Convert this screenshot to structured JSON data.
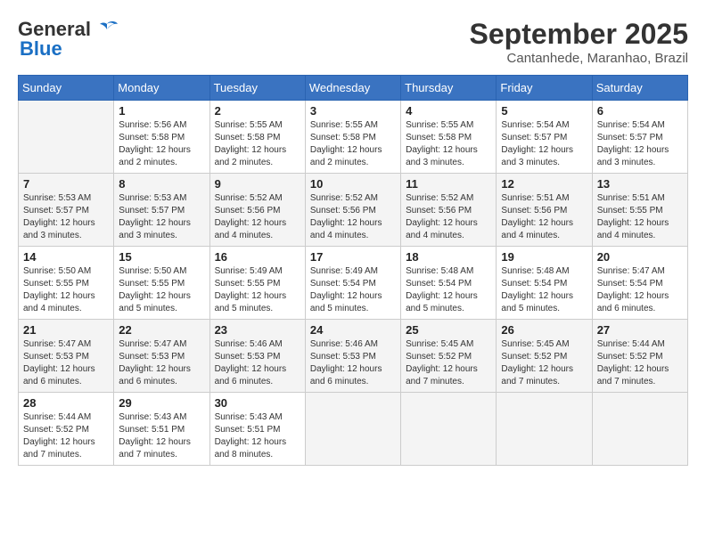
{
  "header": {
    "logo_line1": "General",
    "logo_line2": "Blue",
    "month": "September 2025",
    "location": "Cantanhede, Maranhao, Brazil"
  },
  "days_of_week": [
    "Sunday",
    "Monday",
    "Tuesday",
    "Wednesday",
    "Thursday",
    "Friday",
    "Saturday"
  ],
  "weeks": [
    [
      {
        "day": "",
        "info": ""
      },
      {
        "day": "1",
        "info": "Sunrise: 5:56 AM\nSunset: 5:58 PM\nDaylight: 12 hours\nand 2 minutes."
      },
      {
        "day": "2",
        "info": "Sunrise: 5:55 AM\nSunset: 5:58 PM\nDaylight: 12 hours\nand 2 minutes."
      },
      {
        "day": "3",
        "info": "Sunrise: 5:55 AM\nSunset: 5:58 PM\nDaylight: 12 hours\nand 2 minutes."
      },
      {
        "day": "4",
        "info": "Sunrise: 5:55 AM\nSunset: 5:58 PM\nDaylight: 12 hours\nand 3 minutes."
      },
      {
        "day": "5",
        "info": "Sunrise: 5:54 AM\nSunset: 5:57 PM\nDaylight: 12 hours\nand 3 minutes."
      },
      {
        "day": "6",
        "info": "Sunrise: 5:54 AM\nSunset: 5:57 PM\nDaylight: 12 hours\nand 3 minutes."
      }
    ],
    [
      {
        "day": "7",
        "info": "Sunrise: 5:53 AM\nSunset: 5:57 PM\nDaylight: 12 hours\nand 3 minutes."
      },
      {
        "day": "8",
        "info": "Sunrise: 5:53 AM\nSunset: 5:57 PM\nDaylight: 12 hours\nand 3 minutes."
      },
      {
        "day": "9",
        "info": "Sunrise: 5:52 AM\nSunset: 5:56 PM\nDaylight: 12 hours\nand 4 minutes."
      },
      {
        "day": "10",
        "info": "Sunrise: 5:52 AM\nSunset: 5:56 PM\nDaylight: 12 hours\nand 4 minutes."
      },
      {
        "day": "11",
        "info": "Sunrise: 5:52 AM\nSunset: 5:56 PM\nDaylight: 12 hours\nand 4 minutes."
      },
      {
        "day": "12",
        "info": "Sunrise: 5:51 AM\nSunset: 5:56 PM\nDaylight: 12 hours\nand 4 minutes."
      },
      {
        "day": "13",
        "info": "Sunrise: 5:51 AM\nSunset: 5:55 PM\nDaylight: 12 hours\nand 4 minutes."
      }
    ],
    [
      {
        "day": "14",
        "info": "Sunrise: 5:50 AM\nSunset: 5:55 PM\nDaylight: 12 hours\nand 4 minutes."
      },
      {
        "day": "15",
        "info": "Sunrise: 5:50 AM\nSunset: 5:55 PM\nDaylight: 12 hours\nand 5 minutes."
      },
      {
        "day": "16",
        "info": "Sunrise: 5:49 AM\nSunset: 5:55 PM\nDaylight: 12 hours\nand 5 minutes."
      },
      {
        "day": "17",
        "info": "Sunrise: 5:49 AM\nSunset: 5:54 PM\nDaylight: 12 hours\nand 5 minutes."
      },
      {
        "day": "18",
        "info": "Sunrise: 5:48 AM\nSunset: 5:54 PM\nDaylight: 12 hours\nand 5 minutes."
      },
      {
        "day": "19",
        "info": "Sunrise: 5:48 AM\nSunset: 5:54 PM\nDaylight: 12 hours\nand 5 minutes."
      },
      {
        "day": "20",
        "info": "Sunrise: 5:47 AM\nSunset: 5:54 PM\nDaylight: 12 hours\nand 6 minutes."
      }
    ],
    [
      {
        "day": "21",
        "info": "Sunrise: 5:47 AM\nSunset: 5:53 PM\nDaylight: 12 hours\nand 6 minutes."
      },
      {
        "day": "22",
        "info": "Sunrise: 5:47 AM\nSunset: 5:53 PM\nDaylight: 12 hours\nand 6 minutes."
      },
      {
        "day": "23",
        "info": "Sunrise: 5:46 AM\nSunset: 5:53 PM\nDaylight: 12 hours\nand 6 minutes."
      },
      {
        "day": "24",
        "info": "Sunrise: 5:46 AM\nSunset: 5:53 PM\nDaylight: 12 hours\nand 6 minutes."
      },
      {
        "day": "25",
        "info": "Sunrise: 5:45 AM\nSunset: 5:52 PM\nDaylight: 12 hours\nand 7 minutes."
      },
      {
        "day": "26",
        "info": "Sunrise: 5:45 AM\nSunset: 5:52 PM\nDaylight: 12 hours\nand 7 minutes."
      },
      {
        "day": "27",
        "info": "Sunrise: 5:44 AM\nSunset: 5:52 PM\nDaylight: 12 hours\nand 7 minutes."
      }
    ],
    [
      {
        "day": "28",
        "info": "Sunrise: 5:44 AM\nSunset: 5:52 PM\nDaylight: 12 hours\nand 7 minutes."
      },
      {
        "day": "29",
        "info": "Sunrise: 5:43 AM\nSunset: 5:51 PM\nDaylight: 12 hours\nand 7 minutes."
      },
      {
        "day": "30",
        "info": "Sunrise: 5:43 AM\nSunset: 5:51 PM\nDaylight: 12 hours\nand 8 minutes."
      },
      {
        "day": "",
        "info": ""
      },
      {
        "day": "",
        "info": ""
      },
      {
        "day": "",
        "info": ""
      },
      {
        "day": "",
        "info": ""
      }
    ]
  ]
}
